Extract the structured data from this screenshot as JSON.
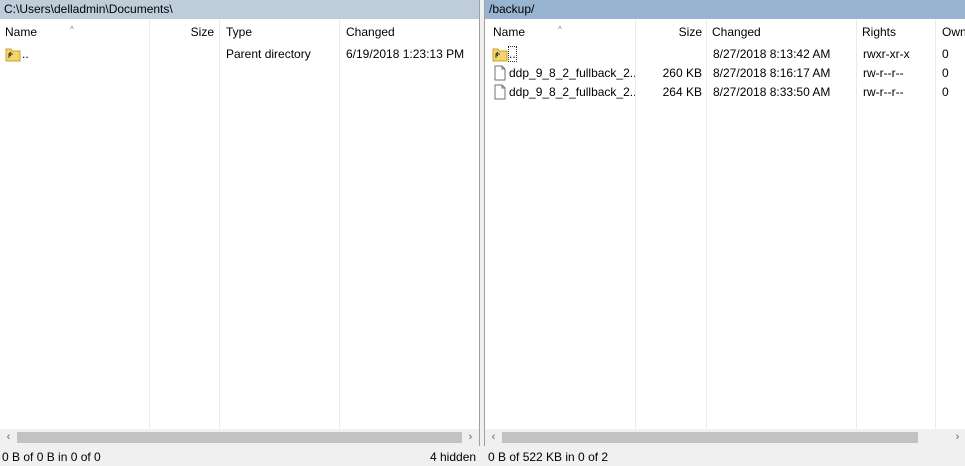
{
  "left": {
    "path": "C:\\Users\\delladmin\\Documents\\",
    "columns": {
      "name": "Name",
      "size": "Size",
      "type": "Type",
      "changed": "Changed"
    },
    "rows": [
      {
        "name": "..",
        "size": "",
        "type": "Parent directory",
        "changed": "6/19/2018  1:23:13 PM"
      }
    ],
    "status": "0 B of 0 B in 0 of 0",
    "hidden": "4 hidden"
  },
  "right": {
    "path": "/backup/",
    "columns": {
      "name": "Name",
      "size": "Size",
      "changed": "Changed",
      "rights": "Rights",
      "owner": "Own"
    },
    "rows": [
      {
        "name": "..",
        "size": "",
        "changed": "8/27/2018 8:13:42 AM",
        "rights": "rwxr-xr-x",
        "owner": "0"
      },
      {
        "name": "ddp_9_8_2_fullback_2...",
        "size": "260 KB",
        "changed": "8/27/2018 8:16:17 AM",
        "rights": "rw-r--r--",
        "owner": "0"
      },
      {
        "name": "ddp_9_8_2_fullback_2...",
        "size": "264 KB",
        "changed": "8/27/2018 8:33:50 AM",
        "rights": "rw-r--r--",
        "owner": "0"
      }
    ],
    "status": "0 B of 522 KB in 0 of 2"
  },
  "scrollbar": {
    "left_arrow": "‹",
    "right_arrow": "›"
  },
  "icons": {
    "parent_dir": "folder-up-icon",
    "file": "file-icon",
    "sort": "sort-ascending-icon"
  },
  "colors": {
    "left_path_bg": "#bfcddb",
    "right_path_bg": "#99b4d1",
    "folder_yellow": "#f5d56b"
  }
}
